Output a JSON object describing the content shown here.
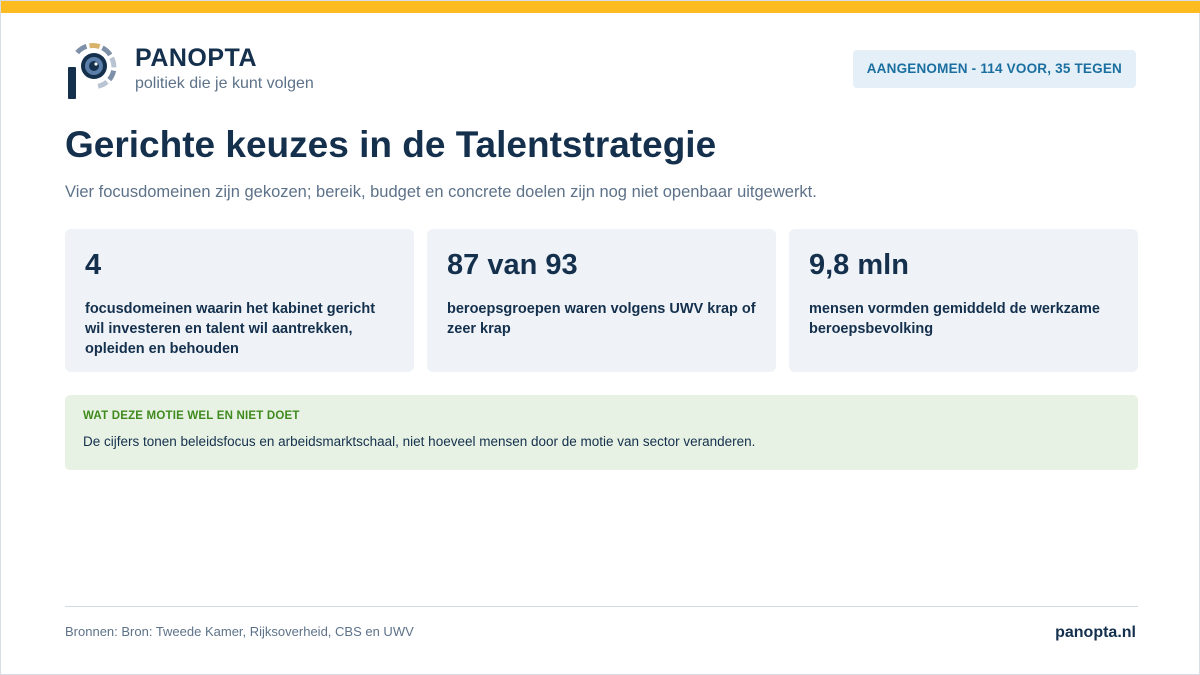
{
  "brand": {
    "name": "PANOPTA",
    "tagline": "politiek die je kunt volgen",
    "logo_icon": "panopta-eye-p-logo-icon"
  },
  "status_badge": "AANGENOMEN - 114 VOOR, 35 TEGEN",
  "title": "Gerichte keuzes in de Talentstrategie",
  "subtitle": "Vier focusdomeinen zijn gekozen; bereik, budget en concrete doelen zijn nog niet openbaar uitgewerkt.",
  "stats": [
    {
      "value": "4",
      "description": "focusdomeinen waarin het kabinet gericht wil investeren en talent wil aantrekken, opleiden en behouden"
    },
    {
      "value": "87 van 93",
      "description": "beroepsgroepen waren volgens UWV krap of zeer krap"
    },
    {
      "value": "9,8 mln",
      "description": "mensen vormden gemiddeld de werkzame beroepsbevolking"
    }
  ],
  "note": {
    "heading": "WAT DEZE MOTIE WEL EN NIET DOET",
    "text": "De cijfers tonen beleidsfocus en arbeidsmarktschaal, niet hoeveel mensen door de motie van sector veranderen."
  },
  "footer": {
    "sources": "Bronnen: Bron: Tweede Kamer, Rijksoverheid, CBS en UWV",
    "site": "panopta.nl"
  },
  "colors": {
    "accent_bar": "#fbbb21",
    "navy": "#14304d",
    "badge_text": "#1b6fa0",
    "note_heading": "#3f8a1e"
  }
}
